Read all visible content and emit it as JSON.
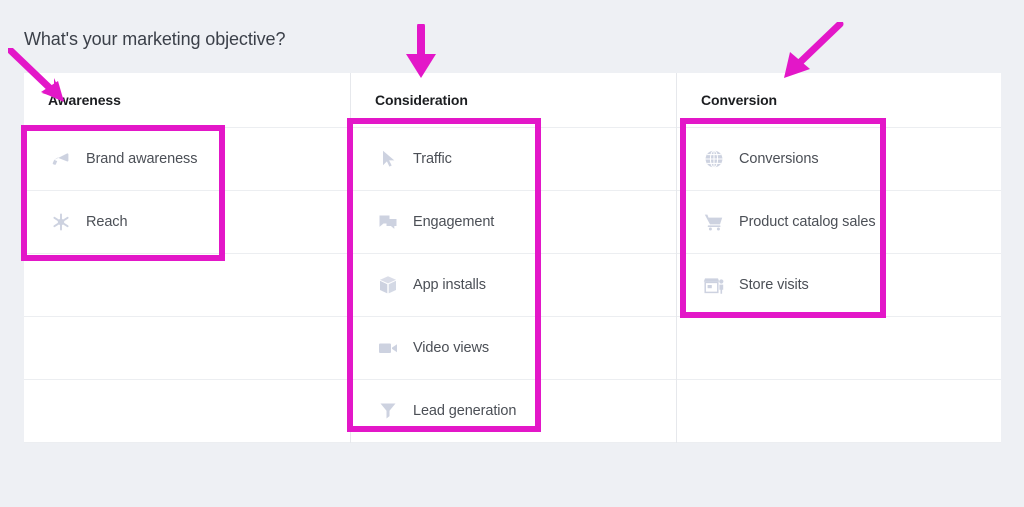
{
  "page": {
    "title": "What's your marketing objective?",
    "background_color": "#eef0f4",
    "card_background": "#ffffff",
    "annotation_color": "#e317c8",
    "text_color": "#4b4f56",
    "icon_color": "#cdd2e0"
  },
  "columns": [
    {
      "id": "awareness",
      "header": "Awareness",
      "highlighted": true,
      "items": [
        {
          "label": "Brand awareness",
          "icon": "megaphone-icon",
          "highlighted": true
        },
        {
          "label": "Reach",
          "icon": "asterisk-burst-icon",
          "highlighted": true
        }
      ]
    },
    {
      "id": "consideration",
      "header": "Consideration",
      "highlighted": true,
      "items": [
        {
          "label": "Traffic",
          "icon": "cursor-arrow-icon",
          "highlighted": true
        },
        {
          "label": "Engagement",
          "icon": "speech-bubbles-icon",
          "highlighted": true
        },
        {
          "label": "App installs",
          "icon": "cube-box-icon",
          "highlighted": true
        },
        {
          "label": "Video views",
          "icon": "video-camera-icon",
          "highlighted": true
        },
        {
          "label": "Lead generation",
          "icon": "funnel-icon",
          "highlighted": true
        }
      ]
    },
    {
      "id": "conversion",
      "header": "Conversion",
      "highlighted": true,
      "items": [
        {
          "label": "Conversions",
          "icon": "globe-icon",
          "highlighted": true
        },
        {
          "label": "Product catalog sales",
          "icon": "shopping-cart-icon",
          "highlighted": true
        },
        {
          "label": "Store visits",
          "icon": "storefront-icon",
          "highlighted": true
        }
      ]
    }
  ],
  "annotations": {
    "arrows": [
      {
        "id": "arrow-awareness",
        "points_to": "Awareness",
        "direction": "down-right"
      },
      {
        "id": "arrow-consideration",
        "points_to": "Consideration",
        "direction": "down"
      },
      {
        "id": "arrow-conversion",
        "points_to": "Conversion",
        "direction": "down-left"
      }
    ],
    "boxes": [
      {
        "id": "hl-awareness",
        "surrounds": "Awareness objectives"
      },
      {
        "id": "hl-consideration",
        "surrounds": "Consideration objectives"
      },
      {
        "id": "hl-conversion",
        "surrounds": "Conversion objectives"
      }
    ]
  }
}
